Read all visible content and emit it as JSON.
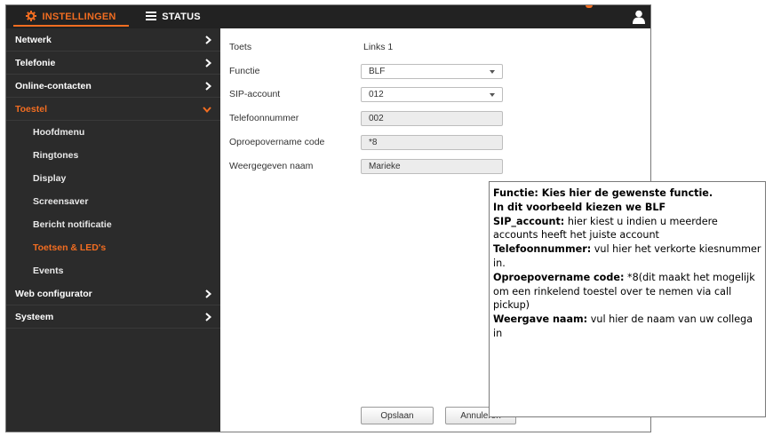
{
  "header": {
    "tab_settings": "INSTELLINGEN",
    "tab_status": "STATUS",
    "accent": "#f26d21"
  },
  "sidebar": {
    "items": [
      {
        "label": "Netwerk",
        "expandable": true
      },
      {
        "label": "Telefonie",
        "expandable": true
      },
      {
        "label": "Online-contacten",
        "expandable": true
      },
      {
        "label": "Toestel",
        "expanded": true,
        "active": true
      },
      {
        "label": "Hoofdmenu"
      },
      {
        "label": "Ringtones"
      },
      {
        "label": "Display"
      },
      {
        "label": "Screensaver"
      },
      {
        "label": "Bericht notificatie"
      },
      {
        "label": "Toetsen & LED's",
        "active": true
      },
      {
        "label": "Events"
      },
      {
        "label": "Web configurator",
        "expandable": true
      },
      {
        "label": "Systeem",
        "expandable": true
      }
    ]
  },
  "form": {
    "toets_label": "Toets",
    "toets_value": "Links 1",
    "functie_label": "Functie",
    "functie_value": "BLF",
    "sip_label": "SIP-account",
    "sip_value": "012",
    "tel_label": "Telefoonnummer",
    "tel_value": "002",
    "pickup_label": "Oproepovername code",
    "pickup_value": "*8",
    "name_label": "Weergegeven naam",
    "name_value": "Marieke",
    "save_label": "Opslaan",
    "cancel_label": "Annuleren"
  },
  "callout": {
    "line1": "Functie: Kies hier de gewenste functie.",
    "line2": "In dit voorbeeld kiezen we BLF",
    "sip_term": "SIP_account:",
    "sip_desc": " hier kiest u indien u meerdere accounts heeft het juiste account",
    "tel_term": "Telefoonnummer:",
    "tel_desc": " vul hier het verkorte kiesnummer in.",
    "pickup_term": "Oproepovername code:",
    "pickup_desc": " *8(dit maakt het mogelijk om een rinkelend toestel over te nemen via call pickup)",
    "name_term": "Weergave naam:",
    "name_desc": " vul hier de naam van uw collega in"
  }
}
